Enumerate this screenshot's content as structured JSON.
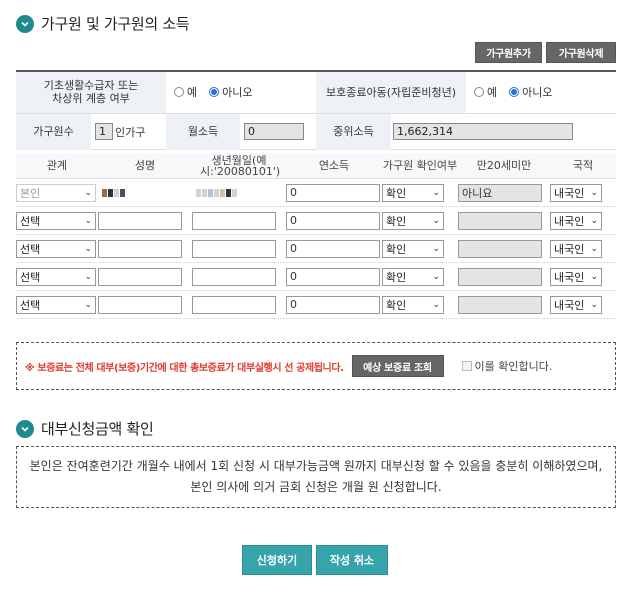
{
  "section1": {
    "title": "가구원 및 가구원의 소득"
  },
  "toolbar": {
    "add_label": "가구원추가",
    "delete_label": "가구원삭제"
  },
  "info": {
    "basic_label": "기초생활수급자 또는\n차상위 계층 여부",
    "protect_label": "보호종료아동(자립준비청년)",
    "yes": "예",
    "no": "아니오",
    "household_label": "가구원수",
    "household_value": "1",
    "household_unit": "인가구",
    "monthly_label": "월소득",
    "monthly_value": "0",
    "median_label": "중위소득",
    "median_value": "1,662,314"
  },
  "members": {
    "headers": [
      "관계",
      "성명",
      "생년월일(예시:'20080101')",
      "연소득",
      "가구원 확인여부",
      "만20세미만",
      "국적"
    ],
    "rows": [
      {
        "relation": "본인",
        "income": "0",
        "confirm": "확인",
        "under20": "아니요",
        "nationality": "내국인"
      },
      {
        "relation": "선택",
        "income": "0",
        "confirm": "확인",
        "under20": "",
        "nationality": "내국인"
      },
      {
        "relation": "선택",
        "income": "0",
        "confirm": "확인",
        "under20": "",
        "nationality": "내국인"
      },
      {
        "relation": "선택",
        "income": "0",
        "confirm": "확인",
        "under20": "",
        "nationality": "내국인"
      },
      {
        "relation": "선택",
        "income": "0",
        "confirm": "확인",
        "under20": "",
        "nationality": "내국인"
      }
    ]
  },
  "notice": {
    "text": "※ 보증료는 전체 대부(보증)기간에 대한 총보증료가 대부실행시 선 공제됩니다.",
    "button": "예상 보증료 조회",
    "check_label": "이를 확인합니다."
  },
  "section2": {
    "title": "대부신청금액 확인"
  },
  "apply": {
    "text": "본인은 잔여훈련기간 개월수 내에서 1회 신청 시 대부가능금액 원까지 대부신청 할 수 있음을 충분히 이해하였으며, 본인 의사에 의거 금회 신청은 개월 원 신청합니다."
  },
  "actions": {
    "submit": "신청하기",
    "cancel": "작성 취소"
  },
  "colors": {
    "accent": "#35a4ac",
    "notice_red": "#e03c31",
    "dark_button": "#666666"
  }
}
